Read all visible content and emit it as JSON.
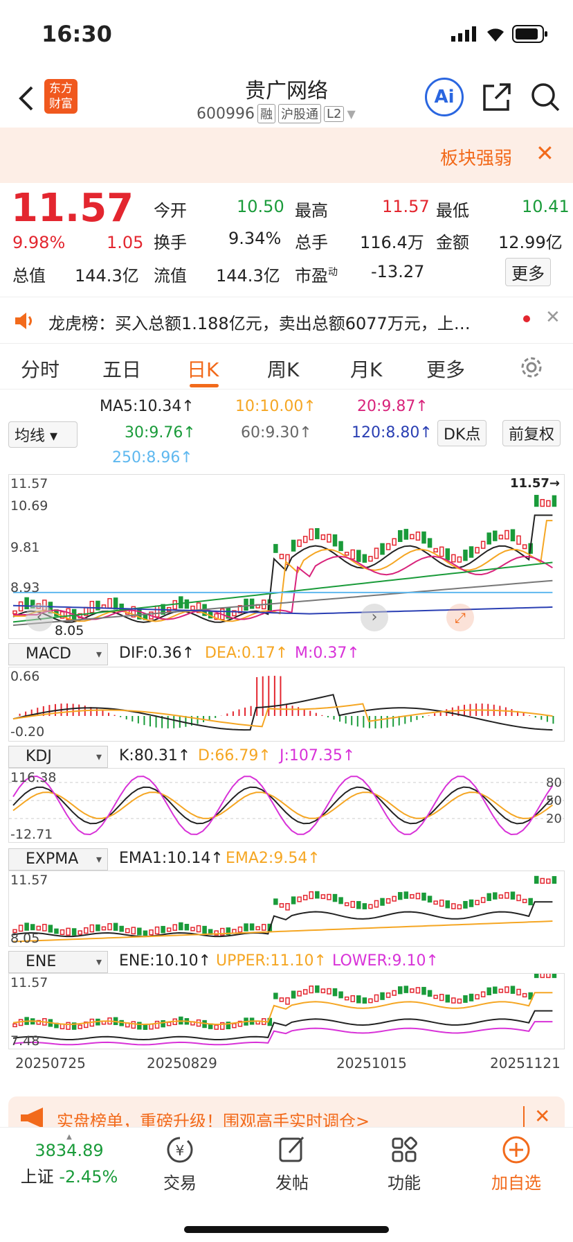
{
  "status": {
    "time": "16:30"
  },
  "header": {
    "title": "贵广网络",
    "code": "600996",
    "tags": [
      "融",
      "沪股通",
      "L2"
    ],
    "logo_text_1": "东方",
    "logo_text_2": "财富",
    "ai_label": "Ai"
  },
  "banner": {
    "text": "板块强弱"
  },
  "quote": {
    "price": "11.57",
    "change_pct": "9.98%",
    "change": "1.05",
    "open_label": "今开",
    "open": "10.50",
    "high_label": "最高",
    "high": "11.57",
    "low_label": "最低",
    "low": "10.41",
    "turnover_label": "换手",
    "turnover": "9.34%",
    "volume_label": "总手",
    "volume": "116.4万",
    "amount_label": "金额",
    "amount": "12.99亿",
    "mktcap_label": "总值",
    "mktcap": "144.3亿",
    "float_label": "流值",
    "float": "144.3亿",
    "pe_label": "市盈",
    "pe_sup": "动",
    "pe": "-13.27",
    "more_label": "更多"
  },
  "notice": {
    "text": "龙虎榜：买入总额1.188亿元，卖出总额6077万元，上…"
  },
  "tabs": [
    "分时",
    "五日",
    "日K",
    "周K",
    "月K",
    "更多"
  ],
  "ma": {
    "select": "均线",
    "ma5": "MA5:10.34↑",
    "ma10": "10:10.00↑",
    "ma20": "20:9.87↑",
    "ma30": "30:9.76↑",
    "ma60": "60:9.30↑",
    "ma120": "120:8.80↑",
    "ma250": "250:8.96↑",
    "dk_label": "DK点",
    "fq_label": "前复权"
  },
  "main_axis": {
    "top": "11.57",
    "v2": "10.69",
    "v3": "9.81",
    "v4": "8.93",
    "low_label": "8.05",
    "last": "11.57→"
  },
  "macd": {
    "select": "MACD",
    "dif": "DIF:0.36↑",
    "dea": "DEA:0.17↑",
    "m": "M:0.37↑",
    "top": "0.66",
    "bottom": "-0.20"
  },
  "kdj": {
    "select": "KDJ",
    "k": "K:80.31↑",
    "d": "D:66.79↑",
    "j": "J:107.35↑",
    "top": "116.38",
    "bottom": "-12.71",
    "l80": "80",
    "l50": "50",
    "l20": "20"
  },
  "expma": {
    "select": "EXPMA",
    "ema1": "EMA1:10.14↑",
    "ema2": "EMA2:9.54↑",
    "top": "11.57",
    "bottom": "8.05"
  },
  "ene": {
    "select": "ENE",
    "ene": "ENE:10.10↑",
    "upper": "UPPER:11.10↑",
    "lower": "LOWER:9.10↑",
    "top": "11.57",
    "bottom": "7.48"
  },
  "dates": [
    "20250725",
    "20250829",
    "20251015",
    "20251121"
  ],
  "promo": {
    "text": "实盘榜单，重磅升级！围观高手实时调仓>"
  },
  "index": {
    "value": "3834.89",
    "name": "上证",
    "change": "-2.45%"
  },
  "nav": [
    "交易",
    "发帖",
    "功能",
    "加自选"
  ],
  "colors": {
    "red": "#e3262f",
    "green": "#1a9b3a",
    "orange": "#f5a623",
    "magenta": "#d832d8",
    "blue": "#2a3fb3",
    "lightblue": "#5fb8ef",
    "accent": "#f26a1b"
  }
}
